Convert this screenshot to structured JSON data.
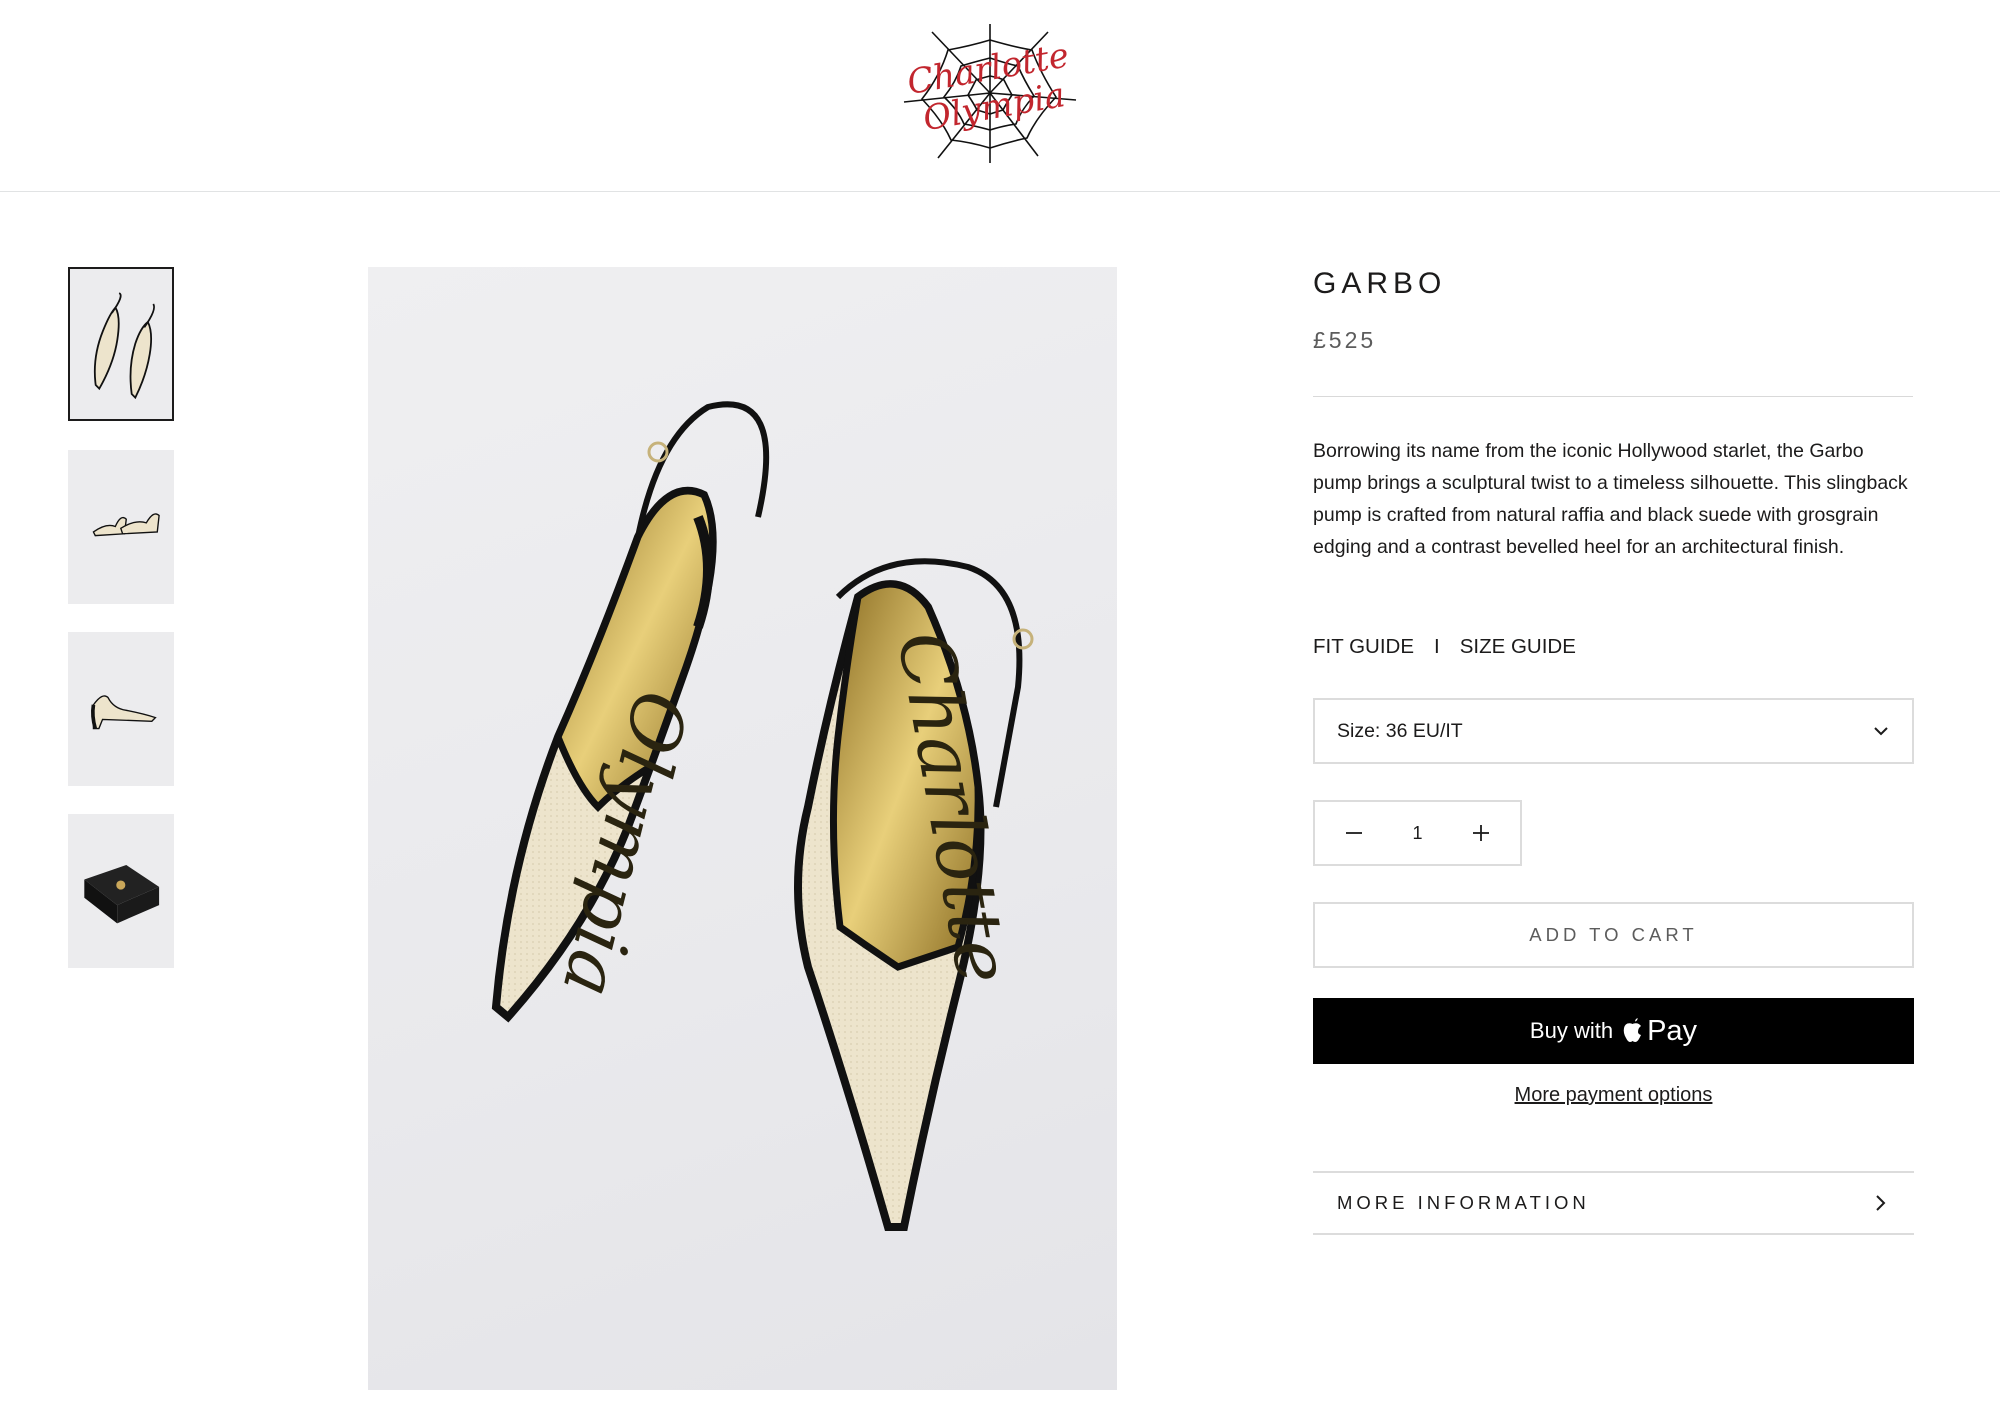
{
  "header": {
    "logo_text": "Charlotte Olympia"
  },
  "gallery": {
    "thumbnails": [
      {
        "alt": "pair top view"
      },
      {
        "alt": "pair side view"
      },
      {
        "alt": "single side view"
      },
      {
        "alt": "gift box"
      }
    ],
    "active_index": 0,
    "main_image_insole_left": "Olympia",
    "main_image_insole_right": "Charlotte"
  },
  "product": {
    "title": "GARBO",
    "price": "£525",
    "description": "Borrowing its name from the iconic Hollywood starlet, the Garbo pump brings a sculptural twist to a timeless silhouette. This slingback pump is crafted from natural raffia and black suede with grosgrain edging and a contrast bevelled heel for an architectural finish.",
    "fit_guide": "FIT GUIDE",
    "guide_separator": "I",
    "size_guide": "SIZE GUIDE",
    "size_selected": "Size: 36 EU/IT",
    "quantity": "1",
    "add_to_cart": "ADD TO CART",
    "buy_with": "Buy with",
    "pay_brand": "Pay",
    "more_payment": "More payment options",
    "more_information": "MORE INFORMATION"
  },
  "colors": {
    "logo_red": "#c2262e",
    "text": "#1c1b1b",
    "muted": "#5c5c5c",
    "border": "#dcdcdc",
    "buy_button_bg": "#000000",
    "shoe_raffia": "#ede4cc",
    "shoe_trim": "#111111",
    "insole_gold": "#c9a94a"
  },
  "icons": {
    "size_dropdown": "chevron-down-icon",
    "quantity_minus": "minus-icon",
    "quantity_plus": "plus-icon",
    "pay_logo": "apple-icon",
    "more_info": "chevron-right-icon"
  }
}
